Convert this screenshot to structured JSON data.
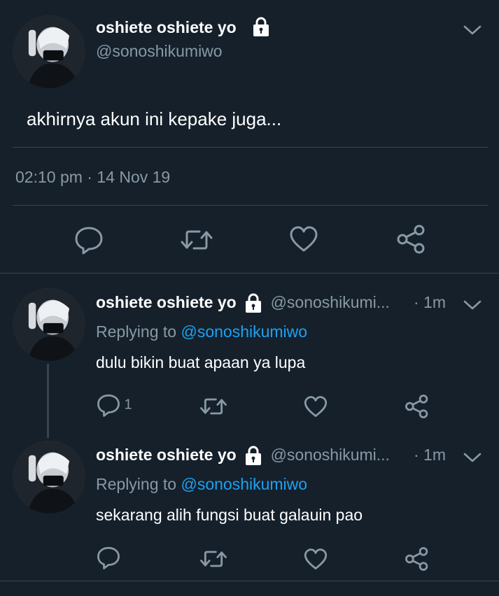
{
  "main_tweet": {
    "name": "oshiete oshiete yo",
    "handle": "@sonoshikumiwo",
    "text": "akhirnya akun ini kepake juga...",
    "time": "02:10 pm",
    "separator": "·",
    "date": "14 Nov 19"
  },
  "replies": [
    {
      "name": "oshiete oshiete yo",
      "handle": "@sonoshikumi...",
      "time": "· 1m",
      "replying_label": "Replying to",
      "replying_to": "@sonoshikumiwo",
      "text": "dulu bikin buat apaan ya lupa",
      "reply_count": "1"
    },
    {
      "name": "oshiete oshiete yo",
      "handle": "@sonoshikumi...",
      "time": "· 1m",
      "replying_label": "Replying to",
      "replying_to": "@sonoshikumiwo",
      "text": "sekarang alih fungsi buat galauin pao",
      "reply_count": ""
    }
  ],
  "icons": [
    "lock-icon",
    "chevron-down-icon",
    "reply-icon",
    "retweet-icon",
    "like-icon",
    "share-icon"
  ],
  "colors": {
    "background": "#15202b",
    "text": "#ffffff",
    "muted": "#8899a6",
    "accent": "#1da1f2",
    "divider": "#38444d"
  }
}
